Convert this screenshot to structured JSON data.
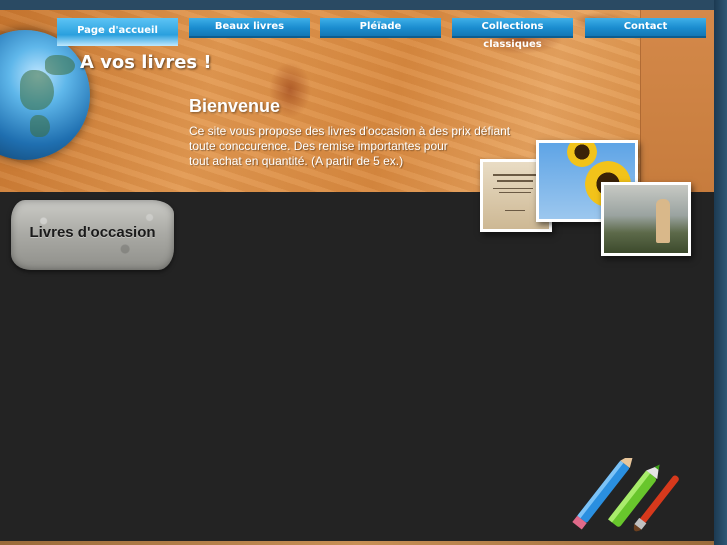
{
  "site": {
    "title": "A vos livres !"
  },
  "nav": {
    "items": [
      {
        "label": "Page d'accueil",
        "active": true
      },
      {
        "label": "Beaux livres",
        "active": false
      },
      {
        "label": "Pléïade",
        "active": false
      },
      {
        "label": "Collections classiques",
        "active": false
      },
      {
        "label": "Contact",
        "active": false
      }
    ]
  },
  "welcome": {
    "heading": "Bienvenue",
    "lines": [
      "Ce site vous propose des livres d'occasion à des prix défiant",
      "toute conccurence. Des remise importantes pour",
      "tout achat en quantité. (A partir de 5 ex.)"
    ]
  },
  "sidebar": {
    "stone_label": "Livres d'occasion"
  },
  "icons": [
    "globe-icon",
    "pencils-icon"
  ],
  "colors": {
    "nav_blue": "#1a8ccf",
    "nav_active": "#5cc4f5",
    "page_bg": "#232323",
    "frame_bg": "#2a4a63"
  }
}
